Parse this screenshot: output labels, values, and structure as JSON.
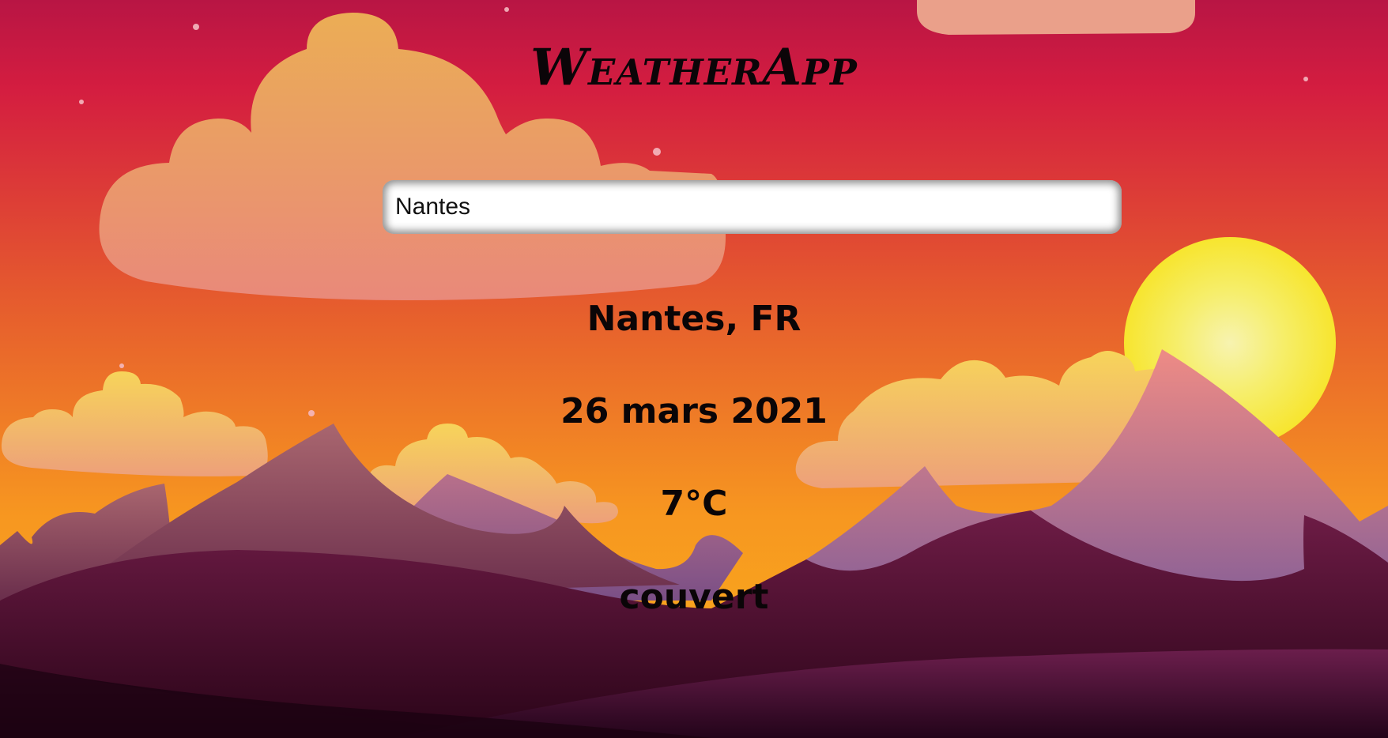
{
  "app": {
    "title": "WeatherApp"
  },
  "search": {
    "value": "Nantes"
  },
  "weather": {
    "location": "Nantes, FR",
    "date": "26 mars 2021",
    "temperature": "7°C",
    "description": "couvert"
  },
  "colors": {
    "sky_top": "#c3173e",
    "sky_mid": "#e55a2c",
    "sky_bottom": "#f7a81c",
    "sun": "#f6e93a",
    "cloud_orange": "#ec9a6a",
    "mountain_pink": "#d58a8c",
    "hill_dark": "#3a0b2a"
  }
}
